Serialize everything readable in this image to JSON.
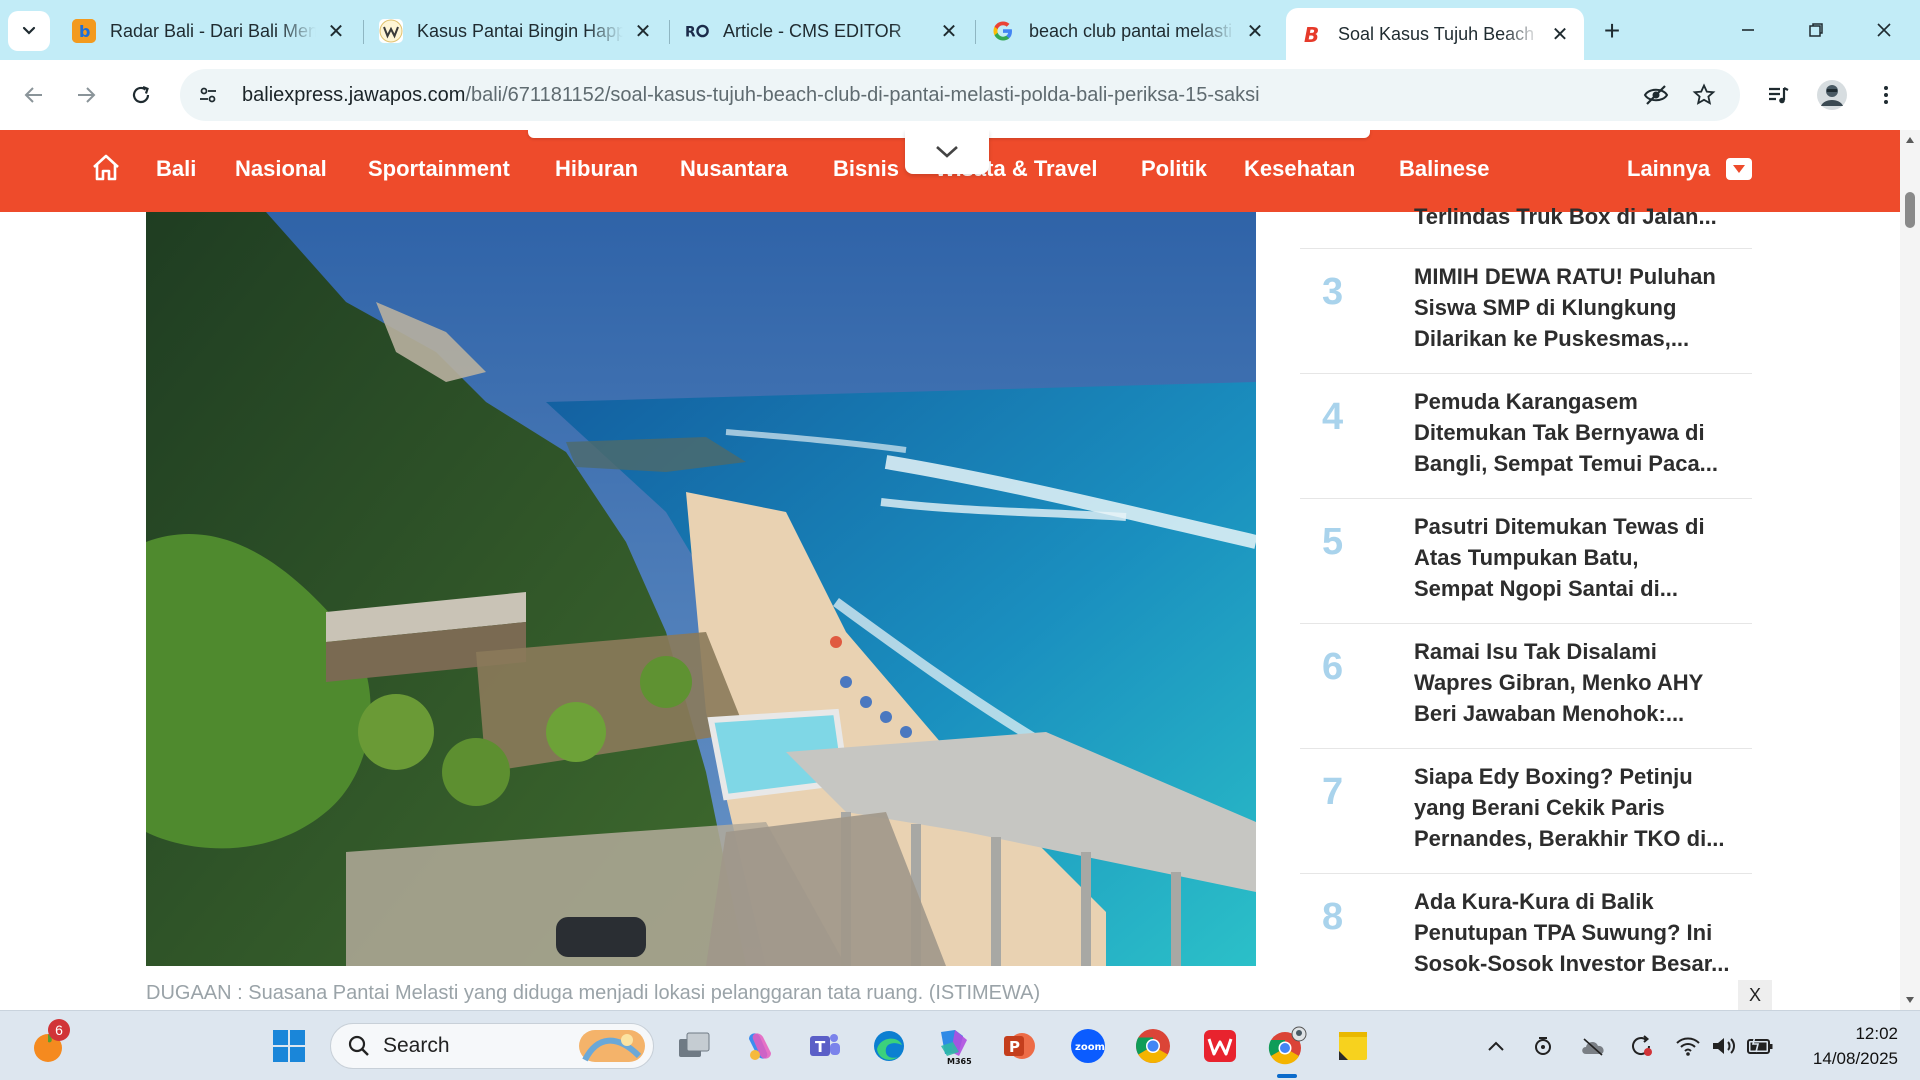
{
  "browser": {
    "tabs": [
      {
        "title": "Radar Bali - Dari Bali Menuju Dunia",
        "favicon": "b-blue-icon",
        "active": false
      },
      {
        "title": "Kasus Pantai Bingin Happy",
        "favicon": "w-yellow-icon",
        "active": false
      },
      {
        "title": "Article - CMS EDITOR",
        "favicon": "ro-logo-icon",
        "active": false
      },
      {
        "title": "beach club pantai melasti",
        "favicon": "google-g-icon",
        "active": false
      },
      {
        "title": "Soal Kasus Tujuh Beach Club",
        "favicon": "b-red-icon",
        "active": true
      }
    ],
    "url_host": "baliexpress.jawapos.com",
    "url_path": "/bali/671181152/soal-kasus-tujuh-beach-club-di-pantai-melasti-polda-bali-periksa-15-saksi",
    "new_tab_label": "+"
  },
  "site": {
    "nav": [
      "Bali",
      "Nasional",
      "Sportainment",
      "Hiburan",
      "Nusantara",
      "Bisnis",
      "Wisata & Travel",
      "Politik",
      "Kesehatan",
      "Balinese"
    ],
    "more_label": "Lainnya",
    "brand_color": "#ee4b2b"
  },
  "article": {
    "caption": "DUGAAN : Suasana Pantai Melasti yang diduga menjadi lokasi pelanggaran tata ruang. (ISTIMEWA)"
  },
  "trending": {
    "partial_title": "Terlindas Truk Box di Jalan...",
    "items": [
      {
        "num": "3",
        "lines": [
          "MIMIH DEWA RATU! Puluhan",
          "Siswa SMP di Klungkung",
          "Dilarikan ke Puskesmas,..."
        ]
      },
      {
        "num": "4",
        "lines": [
          "Pemuda Karangasem",
          "Ditemukan Tak Bernyawa di",
          "Bangli, Sempat Temui Paca..."
        ]
      },
      {
        "num": "5",
        "lines": [
          "Pasutri Ditemukan Tewas di",
          "Atas Tumpukan Batu,",
          "Sempat Ngopi Santai di..."
        ]
      },
      {
        "num": "6",
        "lines": [
          "Ramai Isu Tak Disalami",
          "Wapres Gibran, Menko AHY",
          "Beri Jawaban Menohok:..."
        ]
      },
      {
        "num": "7",
        "lines": [
          "Siapa Edy Boxing? Petinju",
          "yang Berani Cekik Paris",
          "Pernandes, Berakhir TKO di..."
        ]
      },
      {
        "num": "8",
        "lines": [
          "Ada Kura-Kura di Balik",
          "Penutupan TPA Suwung? Ini",
          "Sosok-Sosok Investor Besar..."
        ]
      }
    ],
    "close_label": "X"
  },
  "taskbar": {
    "search_label": "Search",
    "notification_count": "6",
    "time": "12:02",
    "date": "14/08/2025",
    "m365_label": "M365",
    "zoom_label": "zoom"
  }
}
